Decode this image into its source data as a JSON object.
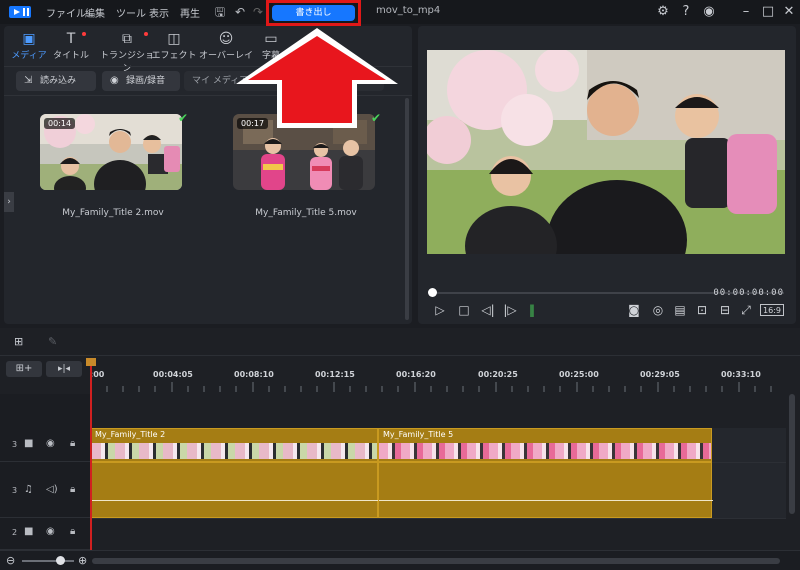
{
  "titlebar": {
    "menu": [
      "ファイル",
      "編集",
      "ツール",
      "表示",
      "再生"
    ],
    "export_label": "書き出し",
    "project_name": "mov_to_mp4"
  },
  "library": {
    "tabs": [
      {
        "label": "メディア",
        "icon": "media-icon",
        "active": true
      },
      {
        "label": "タイトル",
        "icon": "title-icon",
        "dot": true
      },
      {
        "label": "トランジション",
        "icon": "transition-icon",
        "dot": true
      },
      {
        "label": "エフェクト",
        "icon": "effect-icon"
      },
      {
        "label": "オーバーレイ",
        "icon": "overlay-icon"
      },
      {
        "label": "字幕",
        "icon": "subtitle-icon"
      }
    ],
    "import_label": "読み込み",
    "record_label": "録画/録音",
    "search_placeholder": "マイ メディアを検索",
    "items": [
      {
        "duration": "00:14",
        "name": "My_Family_Title 2.mov"
      },
      {
        "duration": "00:17",
        "name": "My_Family_Title 5.mov"
      }
    ]
  },
  "preview": {
    "timecode": "00:00:00:00",
    "aspect": "16:9"
  },
  "timeline": {
    "ticks": [
      ":00",
      "00:04:05",
      "00:08:10",
      "00:12:15",
      "00:16:20",
      "00:20:25",
      "00:25:00",
      "00:29:05",
      "00:33:10"
    ],
    "tracks": [
      {
        "number": "3",
        "type": "video"
      },
      {
        "number": "3",
        "type": "audio"
      },
      {
        "number": "2",
        "type": "video"
      }
    ],
    "clips": [
      {
        "title": "My_Family_Title 2"
      },
      {
        "title": "My_Family_Title 5"
      }
    ]
  },
  "colors": {
    "accent": "#1677ff",
    "highlight_border": "#e01818",
    "arrow": "#e8161d",
    "clip": "#a57d14"
  }
}
